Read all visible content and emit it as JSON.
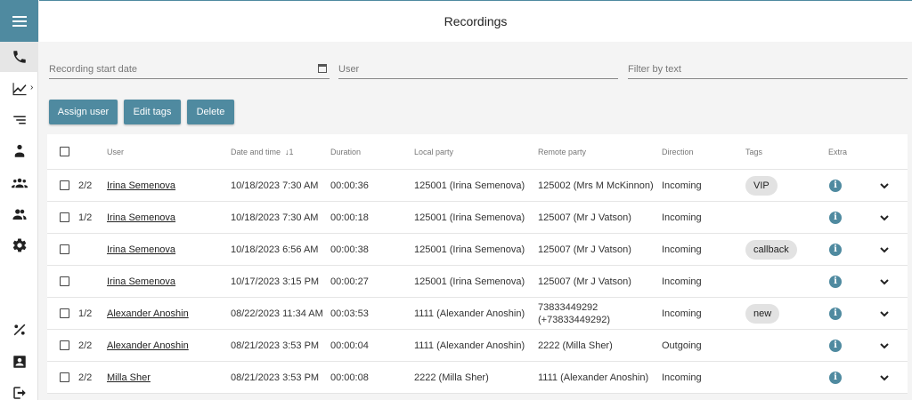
{
  "header": {
    "title": "Recordings"
  },
  "sidebar": {
    "items": [
      {
        "name": "phone-icon",
        "active": true
      },
      {
        "name": "chart-icon"
      },
      {
        "name": "list-icon"
      },
      {
        "name": "user-tree-icon"
      },
      {
        "name": "group-icon"
      },
      {
        "name": "people-icon"
      },
      {
        "name": "gear-icon"
      },
      {
        "name": "percent-icon"
      },
      {
        "name": "contact-card-icon"
      },
      {
        "name": "logout-icon"
      }
    ]
  },
  "filters": {
    "start_date": "Recording start date",
    "user": "User",
    "text": "Filter by text"
  },
  "toolbar": {
    "assign_user": "Assign user",
    "edit_tags": "Edit tags",
    "delete": "Delete"
  },
  "table": {
    "headers": {
      "user": "User",
      "datetime": "Date and time",
      "sort": "1",
      "duration": "Duration",
      "local": "Local party",
      "remote": "Remote party",
      "direction": "Direction",
      "tags": "Tags",
      "extra": "Extra"
    },
    "rows": [
      {
        "count": "2/2",
        "user": "Irina Semenova",
        "datetime": "10/18/2023 7:30 AM",
        "duration": "00:00:36",
        "local": "125001 (Irina Semenova)",
        "remote": "125002 (Mrs M McKinnon)",
        "remote2": "",
        "direction": "Incoming",
        "tag": "VIP"
      },
      {
        "count": "1/2",
        "user": "Irina Semenova",
        "datetime": "10/18/2023 7:30 AM",
        "duration": "00:00:18",
        "local": "125001 (Irina Semenova)",
        "remote": "125007 (Mr J Vatson)",
        "remote2": "",
        "direction": "Incoming",
        "tag": ""
      },
      {
        "count": "",
        "user": "Irina Semenova",
        "datetime": "10/18/2023 6:56 AM",
        "duration": "00:00:38",
        "local": "125001 (Irina Semenova)",
        "remote": "125007 (Mr J Vatson)",
        "remote2": "",
        "direction": "Incoming",
        "tag": "callback"
      },
      {
        "count": "",
        "user": "Irina Semenova",
        "datetime": "10/17/2023 3:15 PM",
        "duration": "00:00:27",
        "local": "125001 (Irina Semenova)",
        "remote": "125007 (Mr J Vatson)",
        "remote2": "",
        "direction": "Incoming",
        "tag": ""
      },
      {
        "count": "1/2",
        "user": "Alexander Anoshin",
        "datetime": "08/22/2023 11:34 AM",
        "duration": "00:03:53",
        "local": "1111 (Alexander Anoshin)",
        "remote": "73833449292",
        "remote2": "(+73833449292)",
        "direction": "Incoming",
        "tag": "new"
      },
      {
        "count": "2/2",
        "user": "Alexander Anoshin",
        "datetime": "08/21/2023 3:53 PM",
        "duration": "00:00:04",
        "local": "1111 (Alexander Anoshin)",
        "remote": "2222 (Milla Sher)",
        "remote2": "",
        "direction": "Outgoing",
        "tag": ""
      },
      {
        "count": "2/2",
        "user": "Milla Sher",
        "datetime": "08/21/2023 3:53 PM",
        "duration": "00:00:08",
        "local": "2222 (Milla Sher)",
        "remote": "1111 (Alexander Anoshin)",
        "remote2": "",
        "direction": "Incoming",
        "tag": ""
      }
    ]
  }
}
